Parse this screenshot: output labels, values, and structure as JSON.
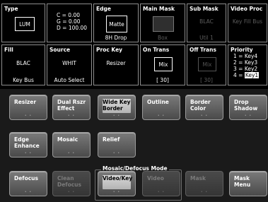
{
  "type_cell": {
    "title": "Type",
    "value": "LUM"
  },
  "cgd_cell": {
    "c": "C = 0.00",
    "g": "G = 0.00",
    "d": "D = 100.00"
  },
  "edge_cell": {
    "title": "Edge",
    "value": "Matte",
    "sub": "8H Drop"
  },
  "main_mask_cell": {
    "title": "Main Mask",
    "sub": "Box"
  },
  "sub_mask_cell": {
    "title": "Sub Mask",
    "value": "BLAC",
    "sub": "Util 1"
  },
  "video_proc_cell": {
    "title": "Video Proc",
    "value": "Key Fill Bus"
  },
  "fill_cell": {
    "title": "Fill",
    "value": "BLAC",
    "sub": "Key Bus"
  },
  "source_cell": {
    "title": "Source",
    "value": "WHIT",
    "sub": "Auto Select"
  },
  "proc_key_cell": {
    "title": "Proc Key",
    "value": "Resizer"
  },
  "on_trans_cell": {
    "title": "On Trans",
    "value": "Mix",
    "sub": "[ 30]"
  },
  "off_trans_cell": {
    "title": "Off Trans",
    "value": "Mix",
    "sub": "[ 30]"
  },
  "priority_cell": {
    "title": "Priority",
    "line1": "1 = Key4",
    "line2": "2 = Key3",
    "line3": "3 = Key2",
    "line4_prefix": "4 = ",
    "line4_hl": "Key1"
  },
  "buttons": {
    "resizer": "Resizer",
    "dual_rszr_1": "Dual Rszr",
    "dual_rszr_2": "Effect",
    "wide_key_1": "Wide Key",
    "wide_key_2": "Border",
    "outline": "Outline",
    "border_color_1": "Border",
    "border_color_2": "Color",
    "drop_shadow_1": "Drop",
    "drop_shadow_2": "Shadow",
    "edge_enhance_1": "Edge",
    "edge_enhance_2": "Enhance",
    "mosaic": "Mosaic",
    "relief": "Relief",
    "defocus": "Defocus",
    "clean_defocus_1": "Clean",
    "clean_defocus_2": "Defocus",
    "video_key": "Video/Key",
    "video": "Video",
    "mask": "Mask",
    "mask_menu": "Mask Menu"
  },
  "mosaic_mode_label": "Mosaic/Defocus Mode",
  "button_dots": "• •"
}
